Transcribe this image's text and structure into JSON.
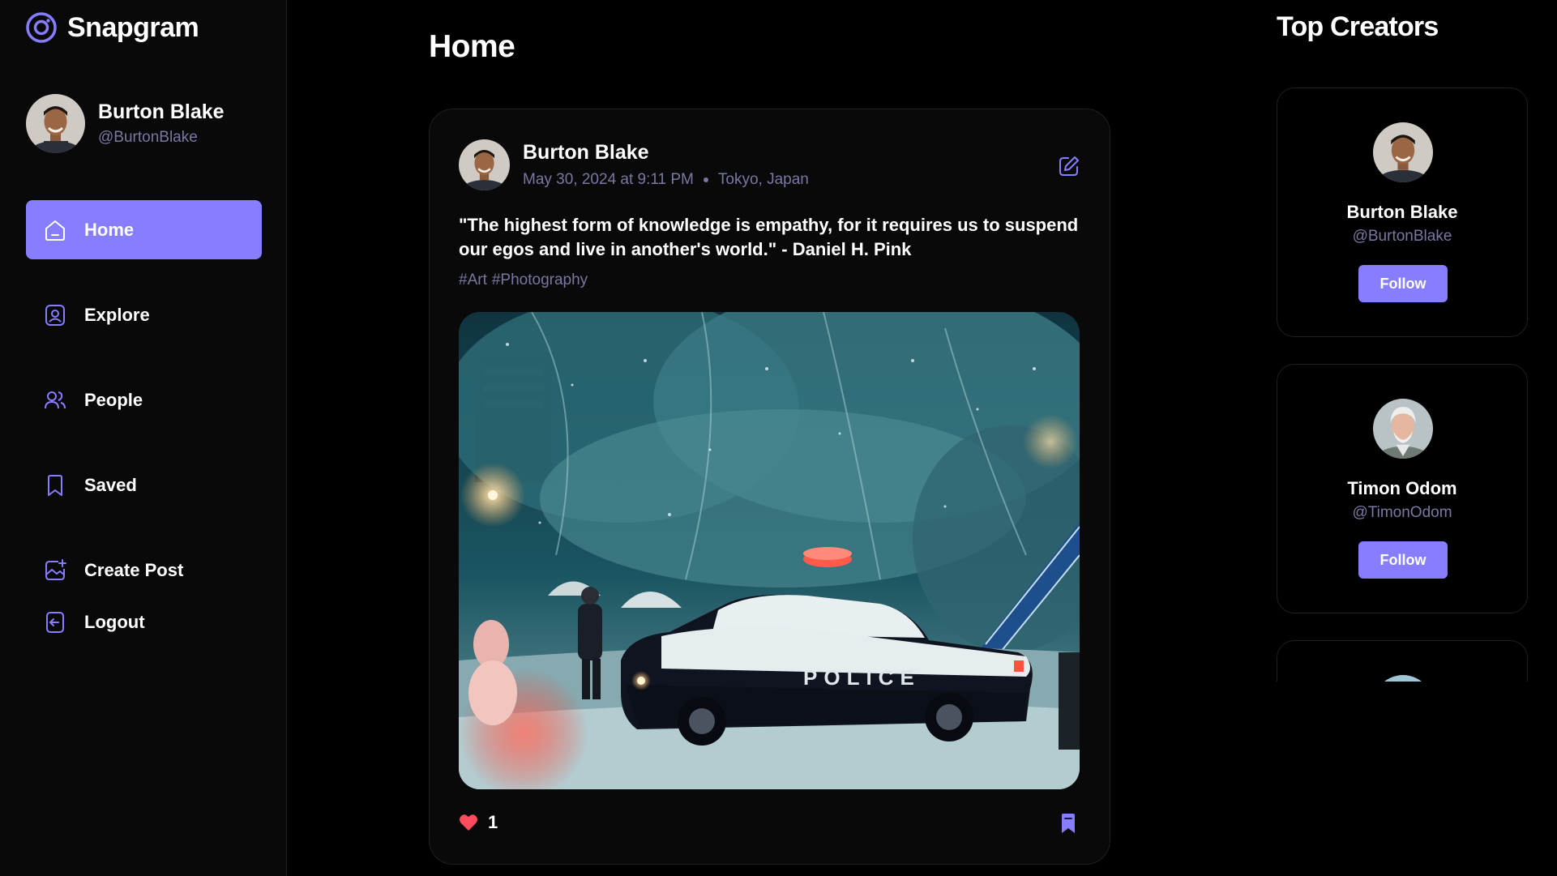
{
  "app": {
    "name": "Snapgram",
    "accent": "#877eff",
    "muted": "#7878a3"
  },
  "user": {
    "name": "Burton Blake",
    "handle": "@BurtonBlake"
  },
  "nav": [
    {
      "label": "Home",
      "icon": "home-icon",
      "active": true
    },
    {
      "label": "Explore",
      "icon": "explore-icon",
      "active": false
    },
    {
      "label": "People",
      "icon": "people-icon",
      "active": false
    },
    {
      "label": "Saved",
      "icon": "bookmark-icon",
      "active": false
    },
    {
      "label": "Create Post",
      "icon": "create-post-icon",
      "active": false
    },
    {
      "label": "Logout",
      "icon": "logout-icon",
      "active": false
    }
  ],
  "main": {
    "title": "Home"
  },
  "post": {
    "author": "Burton Blake",
    "date": "May 30, 2024 at 9:11 PM",
    "location": "Tokyo, Japan",
    "caption": "\"The highest form of knowledge is empathy, for it requires us to suspend our egos and live in another's world.\" - Daniel H. Pink",
    "tags": [
      "#Art",
      "#Photography"
    ],
    "image_alt": "police car in snowy street at night",
    "likes": "1",
    "liked": true,
    "saved": true
  },
  "rail": {
    "title": "Top Creators",
    "follow_label": "Follow",
    "creators": [
      {
        "name": "Burton Blake",
        "handle": "@BurtonBlake"
      },
      {
        "name": "Timon Odom",
        "handle": "@TimonOdom"
      }
    ]
  }
}
